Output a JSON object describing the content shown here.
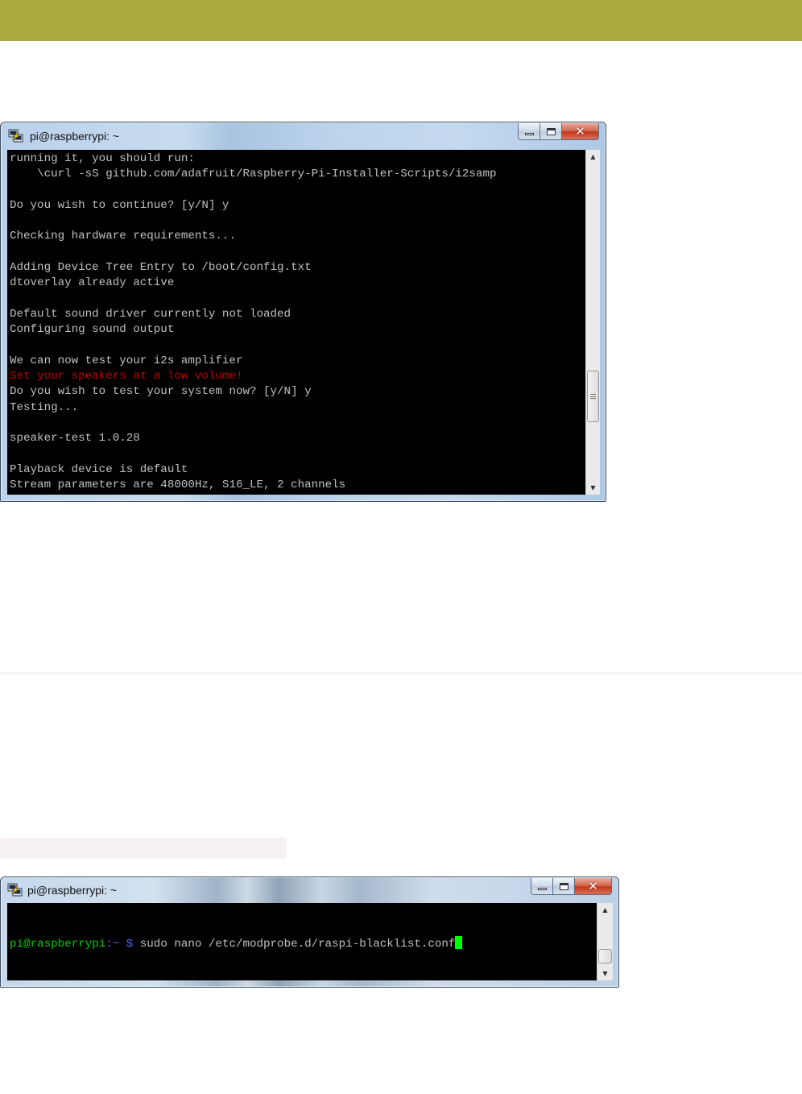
{
  "window1": {
    "title": "pi@raspberrypi: ~",
    "close_glyph": "✕",
    "scroll_up": "▲",
    "scroll_down": "▼",
    "lines": [
      {
        "text": "running it, you should run:",
        "color": "default"
      },
      {
        "text": "    \\curl -sS github.com/adafruit/Raspberry-Pi-Installer-Scripts/i2samp",
        "color": "default"
      },
      {
        "text": "",
        "color": "default"
      },
      {
        "text": "Do you wish to continue? [y/N] y",
        "color": "default"
      },
      {
        "text": "",
        "color": "default"
      },
      {
        "text": "Checking hardware requirements...",
        "color": "default"
      },
      {
        "text": "",
        "color": "default"
      },
      {
        "text": "Adding Device Tree Entry to /boot/config.txt",
        "color": "default"
      },
      {
        "text": "dtoverlay already active",
        "color": "default"
      },
      {
        "text": "",
        "color": "default"
      },
      {
        "text": "Default sound driver currently not loaded",
        "color": "default"
      },
      {
        "text": "Configuring sound output",
        "color": "default"
      },
      {
        "text": "",
        "color": "default"
      },
      {
        "text": "We can now test your i2s amplifier",
        "color": "default"
      },
      {
        "text": "Set your speakers at a low volume!",
        "color": "red"
      },
      {
        "text": "Do you wish to test your system now? [y/N] y",
        "color": "default"
      },
      {
        "text": "Testing...",
        "color": "default"
      },
      {
        "text": "",
        "color": "default"
      },
      {
        "text": "speaker-test 1.0.28",
        "color": "default"
      },
      {
        "text": "",
        "color": "default"
      },
      {
        "text": "Playback device is default",
        "color": "default"
      },
      {
        "text": "Stream parameters are 48000Hz, S16_LE, 2 channels",
        "color": "default"
      }
    ]
  },
  "window2": {
    "title": "pi@raspberrypi: ~",
    "close_glyph": "✕",
    "scroll_up": "▲",
    "scroll_down": "▼",
    "prompt_user": "pi@raspberrypi",
    "prompt_path": ":~",
    "prompt_dollar": " $",
    "command": " sudo nano /etc/modprobe.d/raspi-blacklist.conf"
  },
  "colors": {
    "top_bar": "#a9a93c",
    "terminal_bg": "#000000",
    "terminal_text": "#c0c0c0",
    "warning_text": "#c00000",
    "prompt_user": "#00cc00",
    "prompt_path": "#5a5aff",
    "cursor": "#00ff00"
  }
}
